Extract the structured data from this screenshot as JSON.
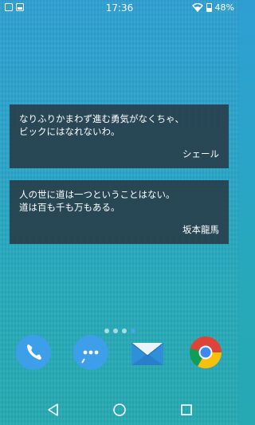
{
  "status_bar": {
    "time": "17:36",
    "battery": "48%",
    "left_icons": [
      "gallery-icon",
      "image-icon"
    ],
    "right_icons": [
      "wifi-icon",
      "battery-icon"
    ]
  },
  "widgets": [
    {
      "quote": "なりふりかまわず進む勇気がなくちゃ、\nビックにはなれないわ。",
      "author": "シェール"
    },
    {
      "quote": "人の世に道は一つということはない。\n道は百も千も万もある。",
      "author": "坂本龍馬"
    }
  ],
  "page_indicator": {
    "count": 4,
    "active_index": 3
  },
  "dock": [
    {
      "name": "Phone",
      "icon": "phone-icon"
    },
    {
      "name": "Messages",
      "icon": "chat-icon"
    },
    {
      "name": "Email",
      "icon": "mail-icon"
    },
    {
      "name": "Chrome",
      "icon": "chrome-icon"
    }
  ],
  "nav_bar": [
    "back-button",
    "home-button",
    "recents-button"
  ],
  "colors": {
    "dock_blue": "#3d9eea",
    "widget_bg": "#283a46"
  }
}
